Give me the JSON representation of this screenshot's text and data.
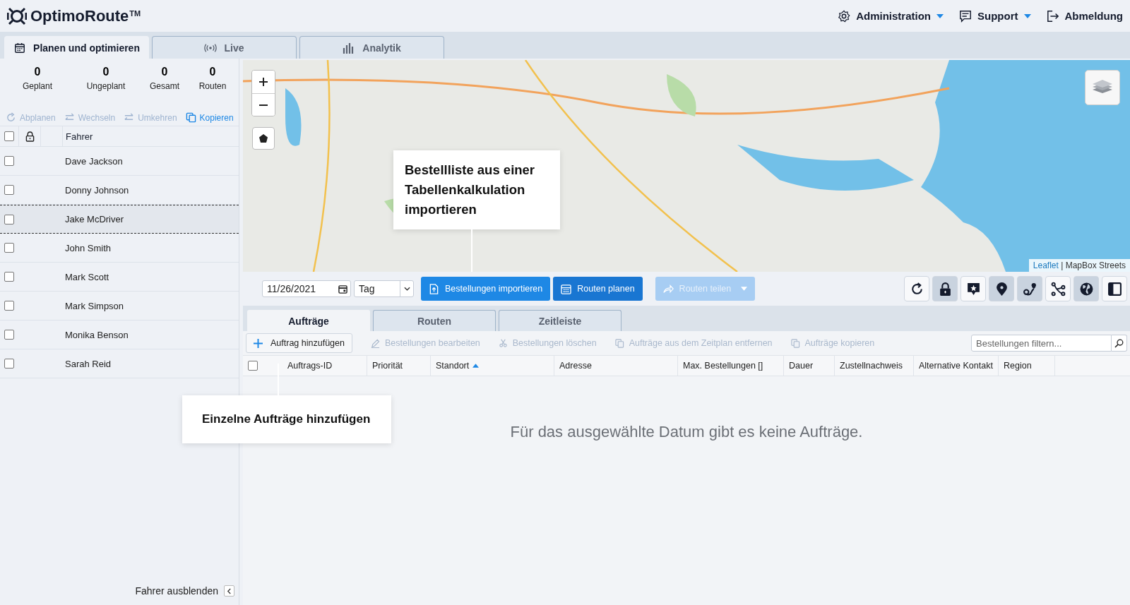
{
  "header": {
    "logo": "OptimoRoute",
    "trademark": "TM",
    "menu": [
      {
        "kind": "gear",
        "label": "Administration",
        "dropdown": true
      },
      {
        "kind": "chat",
        "label": "Support",
        "dropdown": true
      },
      {
        "kind": "logout",
        "label": "Abmeldung",
        "dropdown": false
      }
    ]
  },
  "main_tabs": [
    {
      "kind": "calendar",
      "label": "Planen und optimieren",
      "selected": true
    },
    {
      "kind": "signal",
      "label": "Live",
      "selected": false
    },
    {
      "kind": "bars",
      "label": "Analytik",
      "selected": false
    }
  ],
  "stats": [
    {
      "value": "0",
      "label": "Geplant"
    },
    {
      "value": "0",
      "label": "Ungeplant"
    },
    {
      "value": "0",
      "label": "Gesamt"
    },
    {
      "value": "0",
      "label": "Routen"
    }
  ],
  "driver_actions": [
    {
      "kind": "unschedule",
      "label": "Abplanen",
      "disabled": true
    },
    {
      "kind": "swap",
      "label": "Wechseln",
      "disabled": true
    },
    {
      "kind": "reverse",
      "label": "Umkehren",
      "disabled": true
    },
    {
      "kind": "copy",
      "label": "Kopieren",
      "disabled": false
    }
  ],
  "drivers_select_all": false,
  "drivers_header": "Fahrer",
  "drivers": [
    {
      "name": "Dave Jackson",
      "selected": false,
      "checked": false
    },
    {
      "name": "Donny Johnson",
      "selected": false,
      "checked": false
    },
    {
      "name": "Jake McDriver",
      "selected": true,
      "checked": false
    },
    {
      "name": "John Smith",
      "selected": false,
      "checked": false
    },
    {
      "name": "Mark Scott",
      "selected": false,
      "checked": false
    },
    {
      "name": "Mark Simpson",
      "selected": false,
      "checked": false
    },
    {
      "name": "Monika Benson",
      "selected": false,
      "checked": false
    },
    {
      "name": "Sarah Reid",
      "selected": false,
      "checked": false
    }
  ],
  "hide_drivers": "Fahrer ausblenden",
  "map": {
    "attribution_link": "Leaflet",
    "attribution_text": "| MapBox Streets"
  },
  "toolbar": {
    "date": "11/26/2021",
    "period": "Tag",
    "buttons": [
      {
        "kind": "import",
        "label": "Bestellungen importieren",
        "disabled": false,
        "dropdown": false
      },
      {
        "kind": "plan",
        "label": "Routen planen",
        "disabled": false,
        "dropdown": false
      },
      {
        "kind": "share",
        "label": "Routen teilen",
        "disabled": true,
        "dropdown": true
      }
    ],
    "icon_buttons": [
      {
        "kind": "refresh",
        "active": false
      },
      {
        "kind": "lock",
        "active": true
      },
      {
        "kind": "star-marker",
        "active": false
      },
      {
        "kind": "pin",
        "active": true
      },
      {
        "kind": "route",
        "active": true
      },
      {
        "kind": "branches",
        "active": false
      },
      {
        "kind": "globe",
        "active": true
      },
      {
        "kind": "panel",
        "active": false
      }
    ]
  },
  "sub_tabs": [
    {
      "label": "Aufträge",
      "selected": true
    },
    {
      "label": "Routen",
      "selected": false
    },
    {
      "label": "Zeitleiste",
      "selected": false
    }
  ],
  "order_actions": [
    {
      "kind": "add",
      "label": "Auftrag hinzufügen",
      "disabled": false
    },
    {
      "kind": "edit",
      "label": "Bestellungen bearbeiten",
      "disabled": true
    },
    {
      "kind": "delete",
      "label": "Bestellungen löschen",
      "disabled": true
    },
    {
      "kind": "unschedule",
      "label": "Aufträge aus dem Zeitplan entfernen",
      "disabled": true
    },
    {
      "kind": "copy",
      "label": "Aufträge kopieren",
      "disabled": true
    }
  ],
  "filter": {
    "placeholder": "Bestellungen filtern..."
  },
  "table": {
    "select_all": false,
    "columns": [
      {
        "label": "Auftrags-ID",
        "sorted": false
      },
      {
        "label": "Priorität",
        "sorted": false
      },
      {
        "label": "Standort",
        "sorted": true
      },
      {
        "label": "Adresse",
        "sorted": false
      },
      {
        "label": "Max. Bestellungen []",
        "sorted": false
      },
      {
        "label": "Dauer",
        "sorted": false
      },
      {
        "label": "Zustellnachweis",
        "sorted": false
      },
      {
        "label": "Alternative Kontakt",
        "sorted": false
      },
      {
        "label": "Region",
        "sorted": false
      }
    ],
    "empty_message": "Für das ausgewählte Datum gibt es keine Aufträge."
  },
  "callouts": [
    {
      "kind": "import",
      "text": "Bestellliste aus einer Tabellenkalkulation importieren"
    },
    {
      "kind": "add",
      "text": "Einzelne Aufträge hinzufügen"
    }
  ]
}
